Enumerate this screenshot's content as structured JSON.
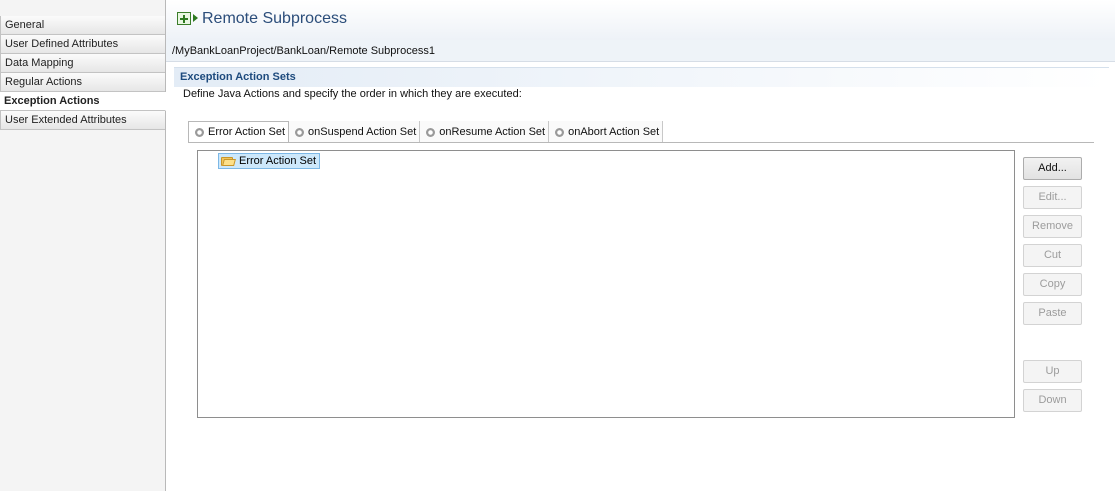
{
  "sidebar": {
    "items": [
      {
        "label": "General"
      },
      {
        "label": "User Defined Attributes"
      },
      {
        "label": "Data Mapping"
      },
      {
        "label": "Regular Actions"
      },
      {
        "label": "Exception Actions"
      },
      {
        "label": "User Extended Attributes"
      }
    ],
    "active": "Exception Actions"
  },
  "header": {
    "title": "Remote Subprocess",
    "path": "/MyBankLoanProject/BankLoan/Remote Subprocess1"
  },
  "section": {
    "title": "Exception Action Sets",
    "description": "Define Java Actions and specify the order in which they are executed:"
  },
  "tabs": [
    {
      "label": "Error Action Set"
    },
    {
      "label": "onSuspend Action Set"
    },
    {
      "label": "onResume Action Set"
    },
    {
      "label": "onAbort Action Set"
    }
  ],
  "tree": {
    "items": [
      {
        "label": "Error Action Set",
        "icon": "folder-open-icon"
      }
    ]
  },
  "buttons": {
    "add": "Add...",
    "edit": "Edit...",
    "remove": "Remove",
    "cut": "Cut",
    "copy": "Copy",
    "paste": "Paste",
    "up": "Up",
    "down": "Down"
  },
  "colors": {
    "title": "#2b4d7a",
    "section_title": "#1d4a7d",
    "selection": "#cde8fb"
  }
}
